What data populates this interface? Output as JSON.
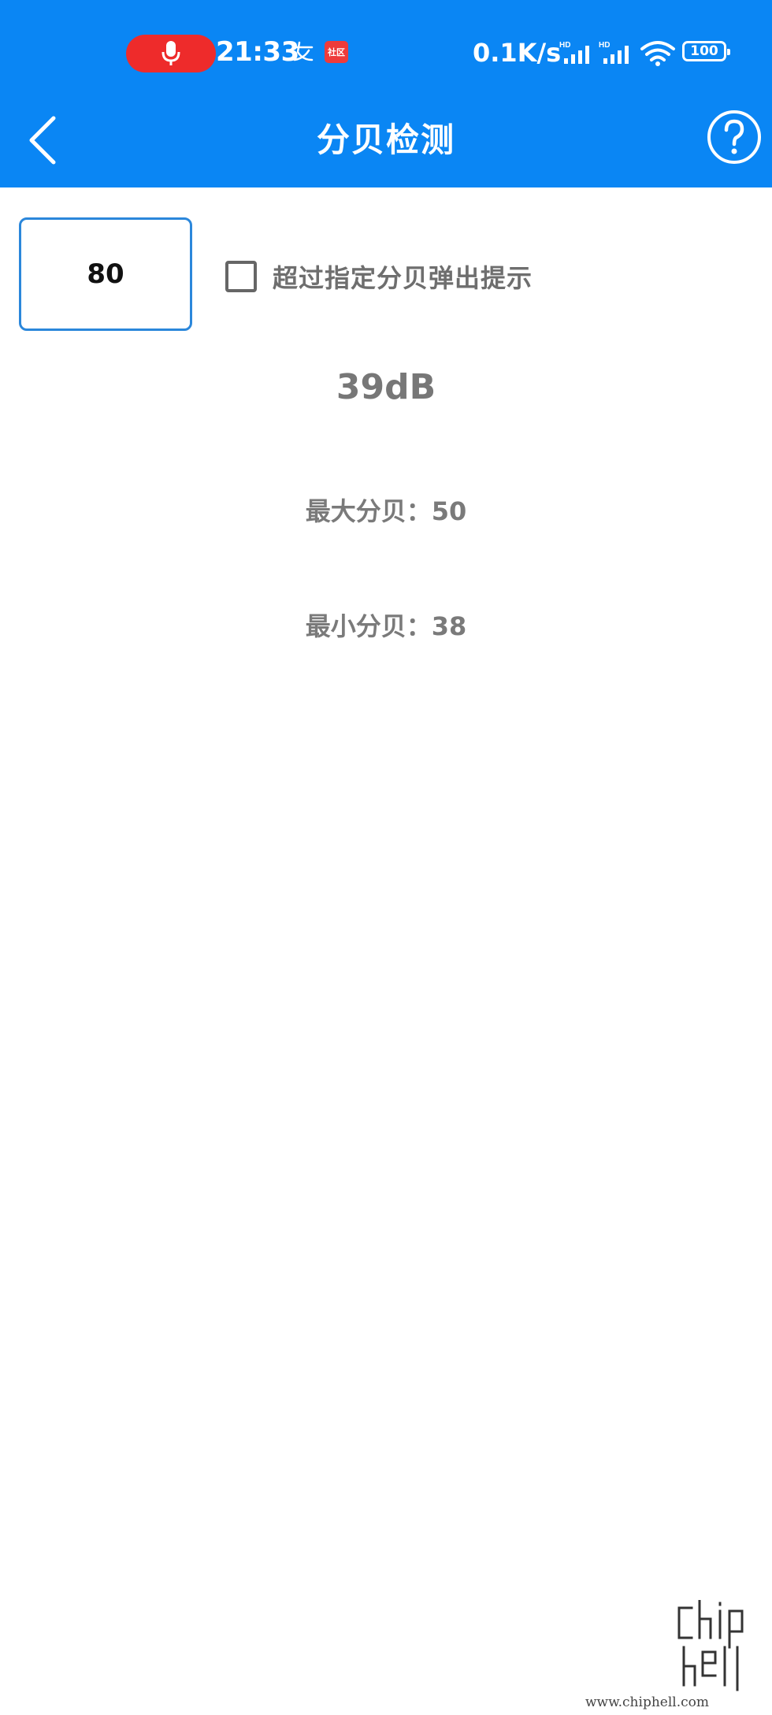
{
  "status_bar": {
    "time": "21:33",
    "net_speed": "0.1K/s",
    "battery": "100",
    "notification_icon_label": "社区"
  },
  "app_bar": {
    "title": "分贝检测"
  },
  "controls": {
    "threshold_value": "80",
    "alert_checkbox_label": "超过指定分贝弹出提示",
    "alert_checked": false
  },
  "readings": {
    "current": "39dB",
    "max_text": "最大分贝：50",
    "min_text": "最小分贝：38"
  },
  "watermark": {
    "logo": "chip\nhell",
    "url": "www.chiphell.com"
  },
  "colors": {
    "primary": "#0a86f4",
    "record_indicator": "#ee2b2b",
    "input_border": "#2b87db",
    "text_gray": "#7a7a7a"
  }
}
